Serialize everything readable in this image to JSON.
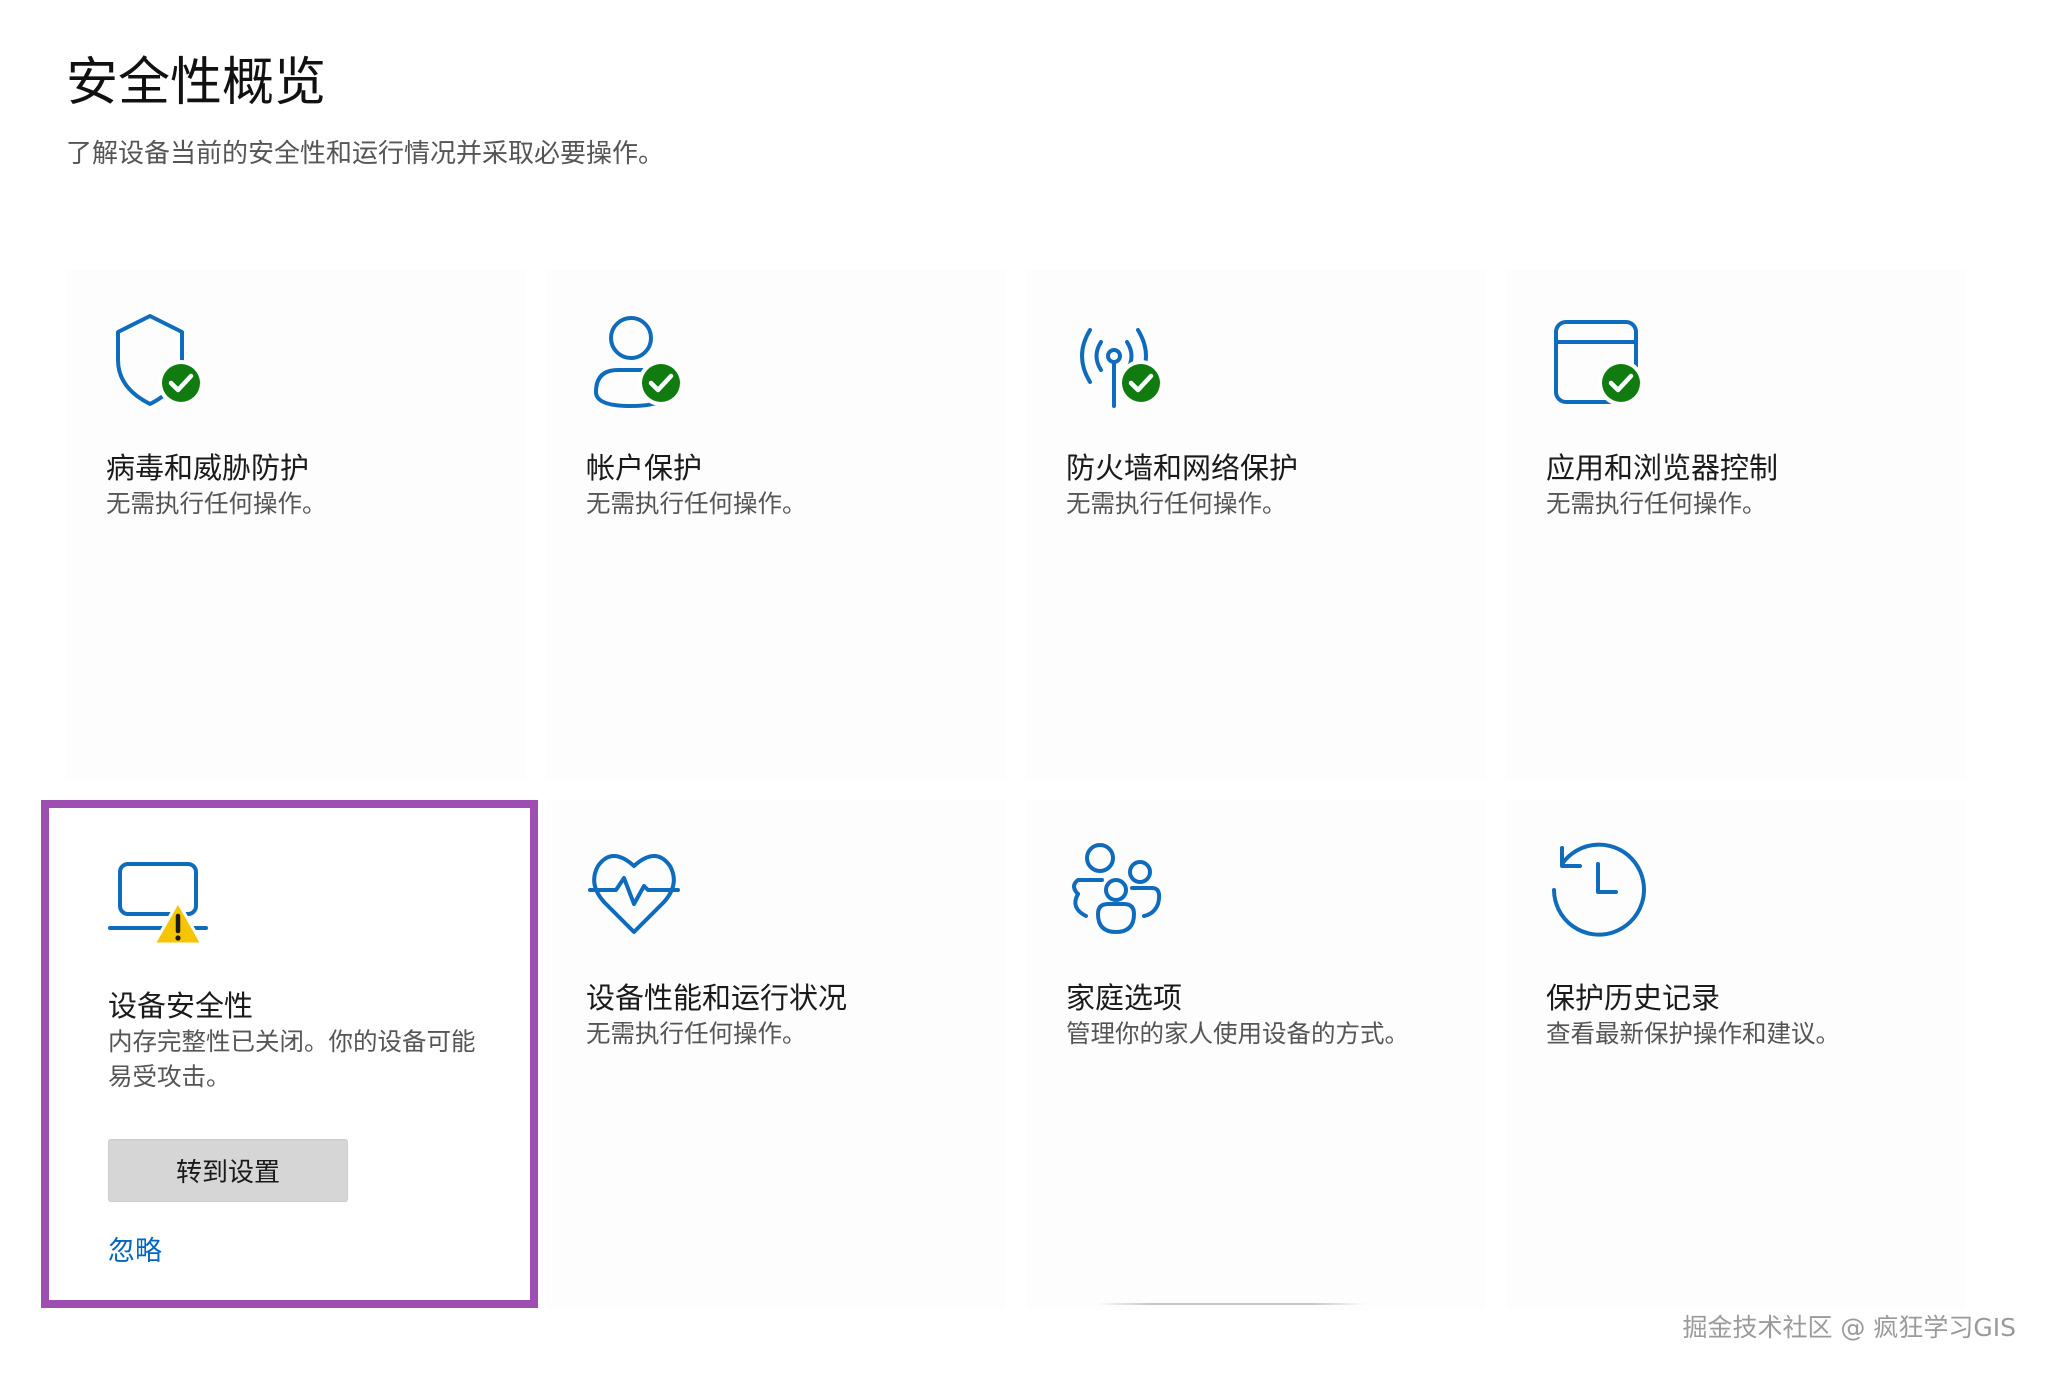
{
  "header": {
    "title": "安全性概览",
    "subtitle": "了解设备当前的安全性和运行情况并采取必要操作。"
  },
  "colors": {
    "accent": "#0067c0",
    "icon_blue": "#0f6cbd",
    "ok_green": "#107c10",
    "warning_yellow": "#f7c400",
    "highlight_border": "#9e4eb0"
  },
  "tiles": {
    "virus": {
      "title": "病毒和威胁防护",
      "description": "无需执行任何操作。",
      "icon": "shield-icon",
      "status": "ok"
    },
    "account": {
      "title": "帐户保护",
      "description": "无需执行任何操作。",
      "icon": "person-icon",
      "status": "ok"
    },
    "firewall": {
      "title": "防火墙和网络保护",
      "description": "无需执行任何操作。",
      "icon": "antenna-icon",
      "status": "ok"
    },
    "app_browser": {
      "title": "应用和浏览器控制",
      "description": "无需执行任何操作。",
      "icon": "browser-window-icon",
      "status": "ok"
    },
    "device_security": {
      "title": "设备安全性",
      "description": "内存完整性已关闭。你的设备可能易受攻击。",
      "icon": "laptop-icon",
      "status": "warning",
      "button_label": "转到设置",
      "link_label": "忽略"
    },
    "performance": {
      "title": "设备性能和运行状况",
      "description": "无需执行任何操作。",
      "icon": "heart-pulse-icon"
    },
    "family": {
      "title": "家庭选项",
      "description": "管理你的家人使用设备的方式。",
      "icon": "family-icon"
    },
    "history": {
      "title": "保护历史记录",
      "description": "查看最新保护操作和建议。",
      "icon": "history-icon"
    }
  },
  "watermark": "掘金技术社区 @ 疯狂学习GIS"
}
